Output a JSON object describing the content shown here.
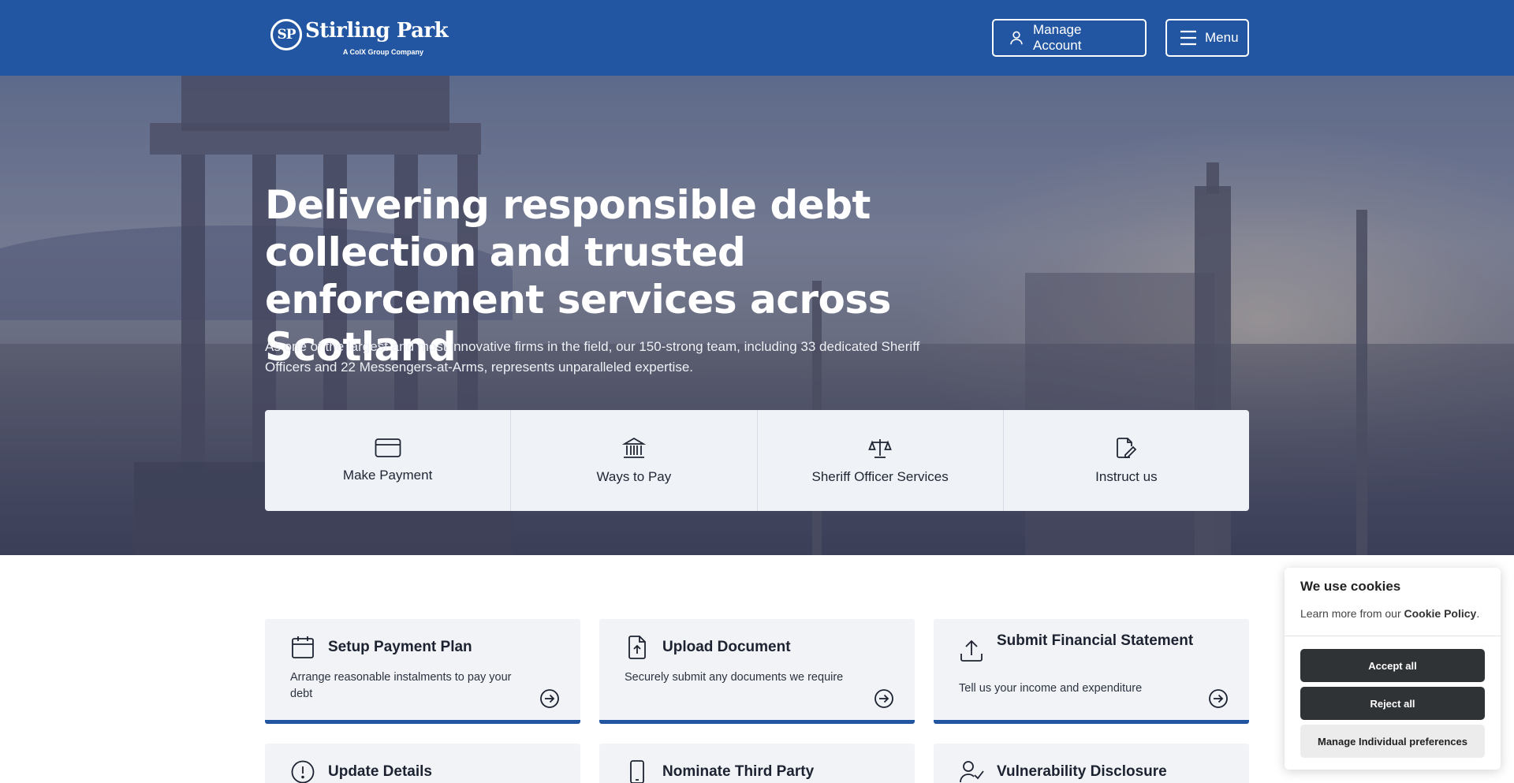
{
  "header": {
    "logo_mark": "SP",
    "logo_name": "Stirling Park",
    "logo_tagline": "A ColX Group Company",
    "manage_account_label": "Manage Account",
    "menu_label": "Menu",
    "background_color": "#2356a2"
  },
  "hero": {
    "title": "Delivering responsible debt collection and trusted enforcement services across Scotland",
    "subtitle": "As one of the largest and most innovative firms in the field, our 150-strong team, including 33 dedicated Sheriff Officers and 22 Messengers-at-Arms, represents unparalleled expertise.",
    "quick_links": [
      {
        "label": "Make Payment",
        "icon": "credit-card-icon"
      },
      {
        "label": "Ways to Pay",
        "icon": "bank-icon"
      },
      {
        "label": "Sheriff Officer Services",
        "icon": "scales-icon"
      },
      {
        "label": "Instruct us",
        "icon": "document-edit-icon"
      }
    ]
  },
  "cards": [
    {
      "title": "Setup Payment Plan",
      "description": "Arrange reasonable instalments to pay your debt",
      "icon": "calendar-icon"
    },
    {
      "title": "Upload Document",
      "description": "Securely submit any documents we require",
      "icon": "file-upload-icon"
    },
    {
      "title": "Submit Financial Statement",
      "description": "Tell us your income and expenditure",
      "icon": "upload-icon"
    },
    {
      "title": "Update Details",
      "description": "",
      "icon": "alert-circle-icon"
    },
    {
      "title": "Nominate Third Party",
      "description": "",
      "icon": "phone-icon"
    },
    {
      "title": "Vulnerability Disclosure",
      "description": "",
      "icon": "user-check-icon"
    }
  ],
  "cookie": {
    "title": "We use cookies",
    "text_prefix": "Learn more from our ",
    "policy_link": "Cookie Policy",
    "text_suffix": ".",
    "accept_label": "Accept all",
    "reject_label": "Reject all",
    "manage_label": "Manage Individual preferences"
  }
}
